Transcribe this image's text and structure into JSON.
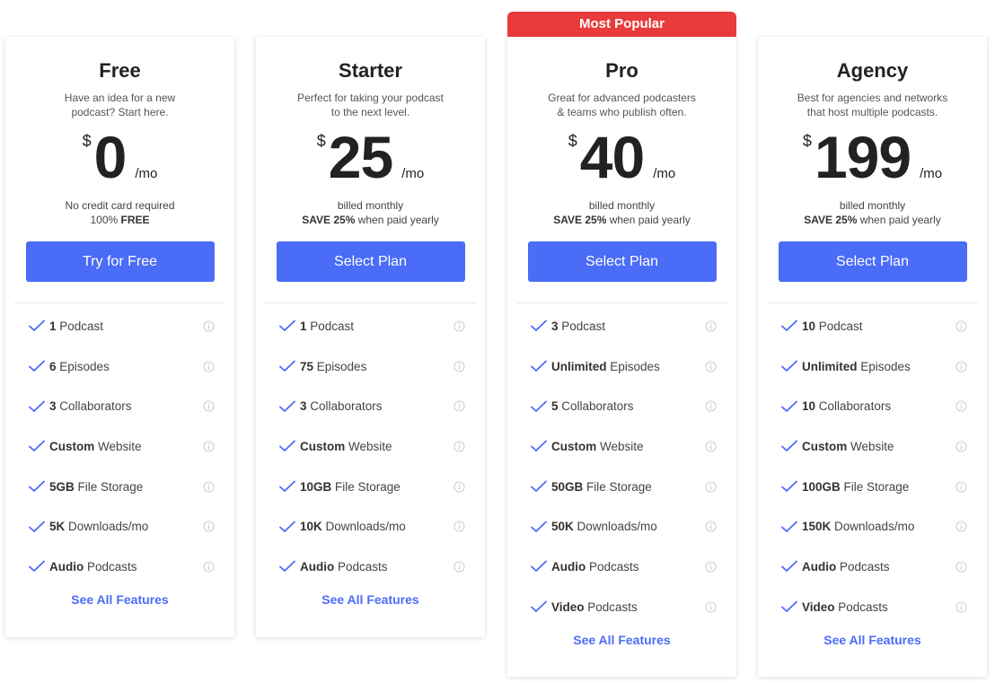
{
  "badge": {
    "label": "Most Popular",
    "color": "#e93b3b"
  },
  "accent": "#4a6cf7",
  "plans": [
    {
      "name": "Free",
      "desc_lines": [
        "Have an idea for a new",
        "podcast? Start here."
      ],
      "currency": "$",
      "amount": "0",
      "period": "/mo",
      "note_line1": "No credit card required",
      "note_line2_plain": "100% ",
      "note_line2_bold": "FREE",
      "note_line2_rest": "",
      "button": "Try for Free",
      "features": [
        {
          "bold": "1",
          "rest": " Podcast"
        },
        {
          "bold": "6",
          "rest": " Episodes"
        },
        {
          "bold": "3",
          "rest": " Collaborators"
        },
        {
          "bold": "Custom",
          "rest": " Website"
        },
        {
          "bold": "5GB",
          "rest": " File Storage"
        },
        {
          "bold": "5K",
          "rest": " Downloads/mo"
        },
        {
          "bold": "Audio",
          "rest": " Podcasts"
        }
      ],
      "see_all": "See All Features"
    },
    {
      "name": "Starter",
      "desc_lines": [
        "Perfect for taking your podcast",
        "to the next level."
      ],
      "currency": "$",
      "amount": "25",
      "period": "/mo",
      "note_line1": "billed monthly",
      "note_line2_plain": "",
      "note_line2_bold": "SAVE 25%",
      "note_line2_rest": " when paid yearly",
      "button": "Select Plan",
      "features": [
        {
          "bold": "1",
          "rest": " Podcast"
        },
        {
          "bold": "75",
          "rest": " Episodes"
        },
        {
          "bold": "3",
          "rest": " Collaborators"
        },
        {
          "bold": "Custom",
          "rest": " Website"
        },
        {
          "bold": "10GB",
          "rest": " File Storage"
        },
        {
          "bold": "10K",
          "rest": " Downloads/mo"
        },
        {
          "bold": "Audio",
          "rest": " Podcasts"
        }
      ],
      "see_all": "See All Features"
    },
    {
      "name": "Pro",
      "desc_lines": [
        "Great for advanced podcasters",
        "& teams who publish often."
      ],
      "currency": "$",
      "amount": "40",
      "period": "/mo",
      "note_line1": "billed monthly",
      "note_line2_plain": "",
      "note_line2_bold": "SAVE 25%",
      "note_line2_rest": " when paid yearly",
      "button": "Select Plan",
      "features": [
        {
          "bold": "3",
          "rest": " Podcast"
        },
        {
          "bold": "Unlimited",
          "rest": " Episodes"
        },
        {
          "bold": "5",
          "rest": " Collaborators"
        },
        {
          "bold": "Custom",
          "rest": " Website"
        },
        {
          "bold": "50GB",
          "rest": " File Storage"
        },
        {
          "bold": "50K",
          "rest": " Downloads/mo"
        },
        {
          "bold": "Audio",
          "rest": " Podcasts"
        },
        {
          "bold": "Video",
          "rest": " Podcasts"
        }
      ],
      "see_all": "See All Features"
    },
    {
      "name": "Agency",
      "desc_lines": [
        "Best for agencies and networks",
        "that host multiple podcasts."
      ],
      "currency": "$",
      "amount": "199",
      "period": "/mo",
      "note_line1": "billed monthly",
      "note_line2_plain": "",
      "note_line2_bold": "SAVE 25%",
      "note_line2_rest": " when paid yearly",
      "button": "Select Plan",
      "features": [
        {
          "bold": "10",
          "rest": " Podcast"
        },
        {
          "bold": "Unlimited",
          "rest": " Episodes"
        },
        {
          "bold": "10",
          "rest": " Collaborators"
        },
        {
          "bold": "Custom",
          "rest": " Website"
        },
        {
          "bold": "100GB",
          "rest": " File Storage"
        },
        {
          "bold": "150K",
          "rest": " Downloads/mo"
        },
        {
          "bold": "Audio",
          "rest": " Podcasts"
        },
        {
          "bold": "Video",
          "rest": " Podcasts"
        }
      ],
      "see_all": "See All Features"
    }
  ]
}
